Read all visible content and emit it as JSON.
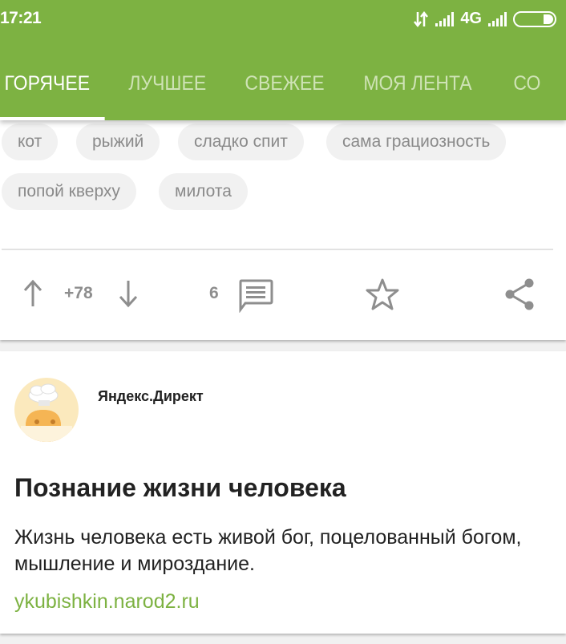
{
  "status_bar": {
    "time": "17:21",
    "network": "4G"
  },
  "tabs": [
    {
      "label": "ГОРЯЧЕЕ",
      "active": true
    },
    {
      "label": "ЛУЧШЕЕ",
      "active": false
    },
    {
      "label": "СВЕЖЕЕ",
      "active": false
    },
    {
      "label": "МОЯ ЛЕНТА",
      "active": false
    },
    {
      "label": "СО",
      "active": false
    }
  ],
  "post": {
    "tags": [
      "кот",
      "рыжий",
      "сладко спит",
      "сама грациозность",
      "попой кверху",
      "милота"
    ],
    "rating": "+78",
    "comments_count": "6"
  },
  "ad": {
    "source": "Яндекс.Директ",
    "title": "Познание жизни человека",
    "text": "Жизнь человека есть живой бог, поцелованный богом, мышление и мироздание.",
    "link": "ykubishkin.narod2.ru"
  },
  "colors": {
    "brand_green": "#7db242",
    "icon_gray": "#8e8e8e"
  }
}
